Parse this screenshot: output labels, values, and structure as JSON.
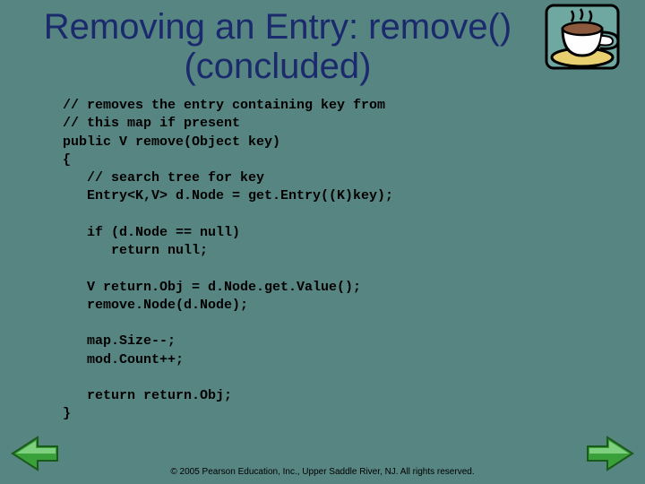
{
  "title": "Removing an Entry: remove() (concluded)",
  "code": "// removes the entry containing key from\n// this map if present\npublic V remove(Object key)\n{\n   // search tree for key\n   Entry<K,V> d.Node = get.Entry((K)key);\n\n   if (d.Node == null)\n      return null;\n\n   V return.Obj = d.Node.get.Value();\n   remove.Node(d.Node);\n\n   map.Size--;\n   mod.Count++;\n\n   return return.Obj;\n}",
  "footer": "© 2005 Pearson Education, Inc., Upper Saddle River, NJ.  All rights reserved.",
  "icons": {
    "prev": "prev-arrow-icon",
    "next": "next-arrow-icon",
    "teacup": "teacup-icon"
  }
}
